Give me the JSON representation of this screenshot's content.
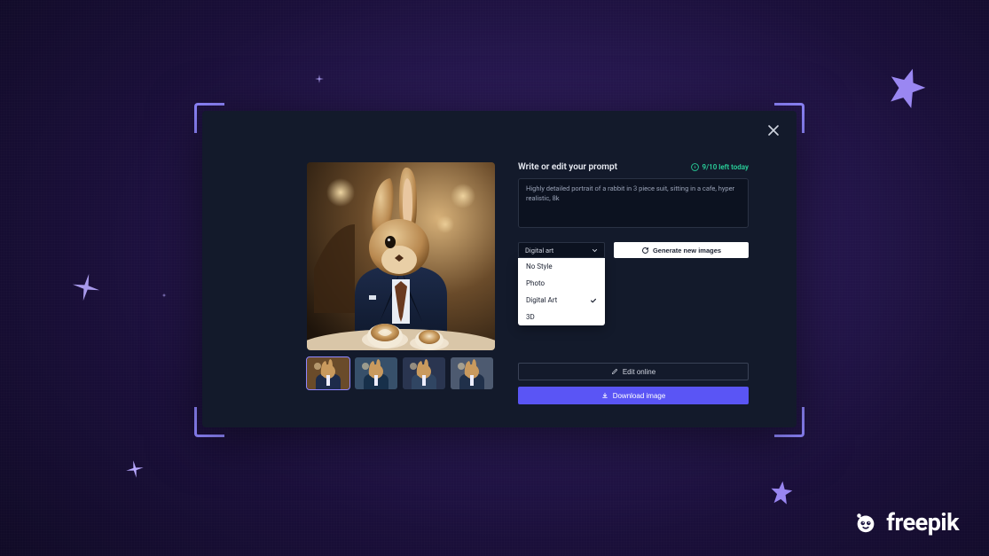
{
  "header": {
    "title": "Write or edit your prompt",
    "credits_label": "9/10 left today"
  },
  "prompt": {
    "text": "Highly detailed portrait of a rabbit in 3 piece suit, sitting in a cafe, hyper realistic, 8k"
  },
  "style": {
    "selected": "Digital art",
    "options": [
      "No Style",
      "Photo",
      "Digital Art",
      "3D"
    ],
    "checked_index": 2
  },
  "actions": {
    "generate": "Generate new images",
    "edit": "Edit online",
    "download": "Download image"
  },
  "thumbs": {
    "count": 4,
    "selected_index": 0
  },
  "brand": {
    "name": "freepik"
  },
  "icons": {
    "close": "close-icon",
    "chevron_down": "chevron-down-icon",
    "refresh": "refresh-icon",
    "pencil": "pencil-icon",
    "download": "download-icon",
    "bolt": "bolt-icon",
    "check": "check-icon"
  },
  "colors": {
    "accent": "#5a55f5",
    "frame": "#8f86ff",
    "success": "#29d19b",
    "panel": "#131a2b",
    "field": "#0c1220"
  }
}
